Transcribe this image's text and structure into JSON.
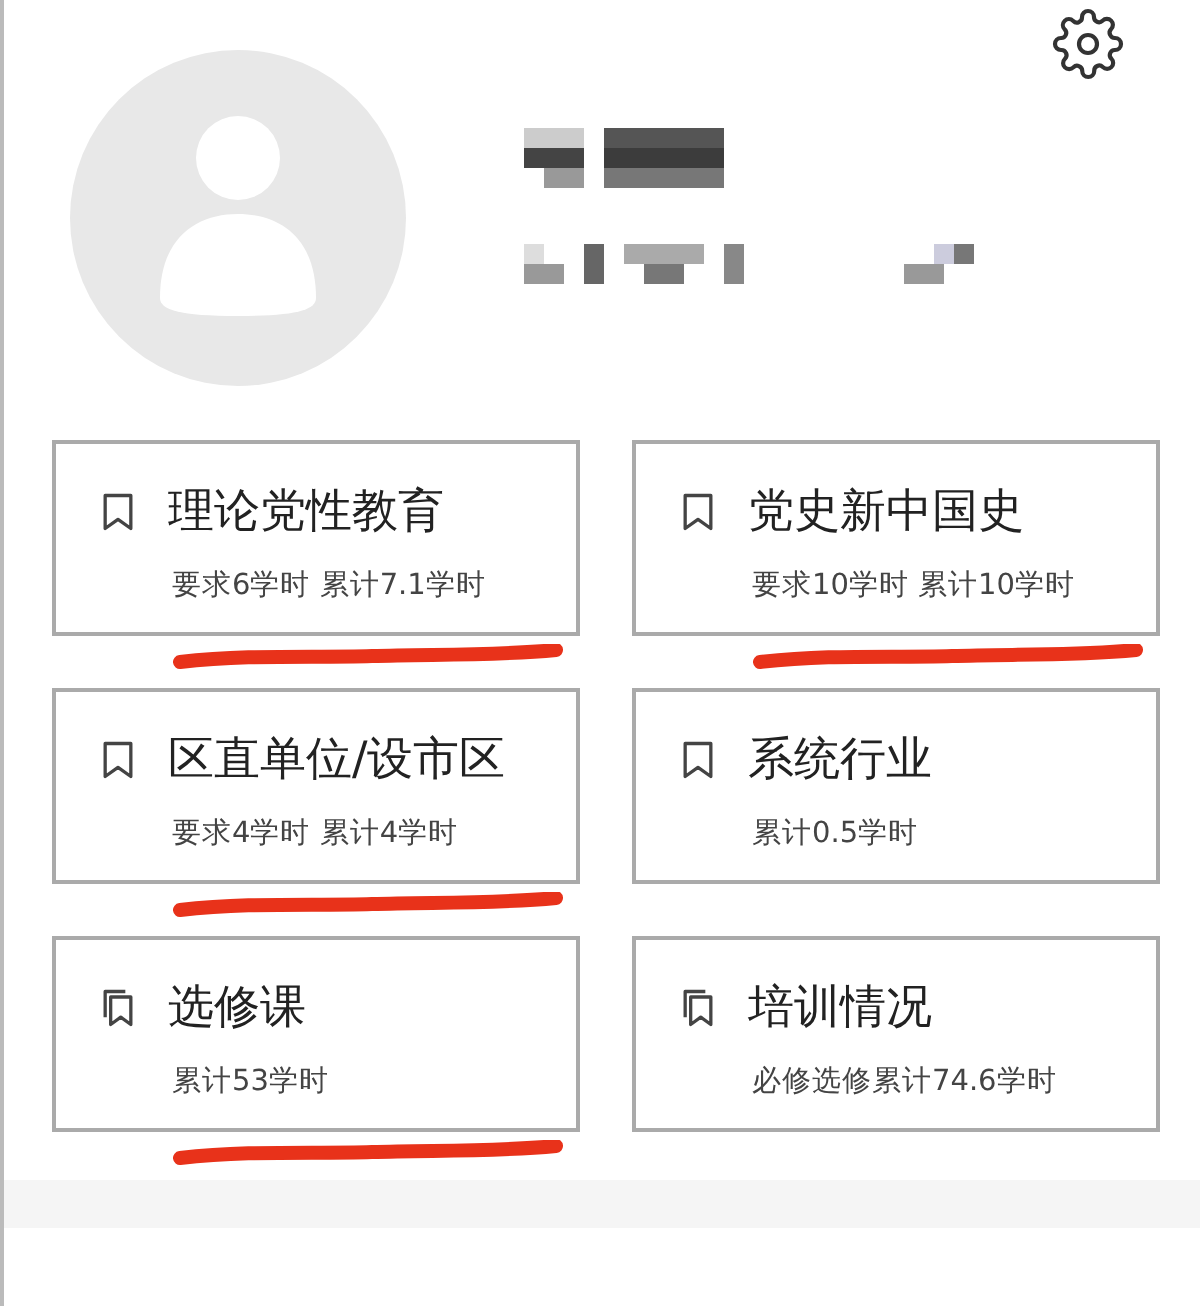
{
  "cards": [
    {
      "title": "理论党性教育",
      "detail": "要求6学时 累计7.1学时",
      "kind": "single",
      "underlined": true
    },
    {
      "title": "党史新中国史",
      "detail": "要求10学时 累计10学时",
      "kind": "single",
      "underlined": true
    },
    {
      "title": "区直单位/设市区",
      "detail": "要求4学时 累计4学时",
      "kind": "single",
      "underlined": true
    },
    {
      "title": "系统行业",
      "detail": "累计0.5学时",
      "kind": "single",
      "underlined": false
    },
    {
      "title": "选修课",
      "detail": "累计53学时",
      "kind": "double",
      "underlined": true
    },
    {
      "title": "培训情况",
      "detail": "必修选修累计74.6学时",
      "kind": "double",
      "underlined": false
    }
  ]
}
